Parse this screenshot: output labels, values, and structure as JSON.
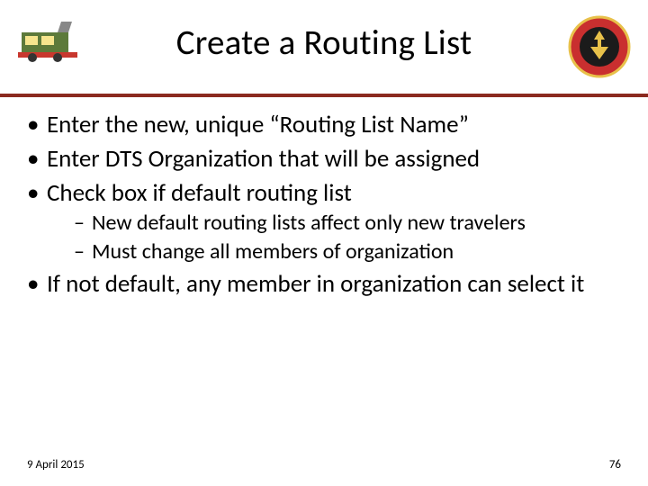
{
  "header": {
    "title": "Create a Routing List",
    "left_icon": "train-logo",
    "right_icon": "navy-seal"
  },
  "bullets": [
    {
      "text": "Enter the new, unique “Routing List Name”"
    },
    {
      "text": "Enter DTS Organization that will be assigned"
    },
    {
      "text": "Check box if default routing list",
      "sub": [
        "New default routing lists affect only new travelers",
        "Must change all members of organization"
      ]
    },
    {
      "text": "If not default, any member in organization can select it"
    }
  ],
  "footer": {
    "date": "9 April 2015",
    "page": "76"
  },
  "colors": {
    "rule": "#8b2a1f"
  }
}
